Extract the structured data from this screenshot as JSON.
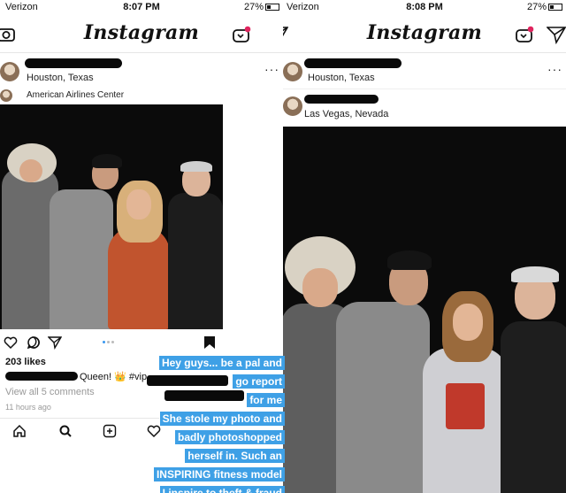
{
  "left": {
    "status": {
      "carrier": "Verizon",
      "time": "8:07 PM",
      "battery": "27%"
    },
    "app_title": "Instagram",
    "post": {
      "location": "Houston, Texas",
      "prev_location": "American Airlines Center",
      "likes": "203 likes",
      "caption_text": "Queen! 👑 #vip",
      "comments_link": "View all 5 comments",
      "time_ago": "11 hours ago"
    }
  },
  "right": {
    "status": {
      "carrier": "Verizon",
      "time": "8:08 PM",
      "battery": "27%"
    },
    "app_title": "Instagram",
    "first_location": "Houston, Texas",
    "post": {
      "location": "Las Vegas, Nevada"
    }
  },
  "annotation": {
    "lines": [
      "Hey guys... be a pal and",
      "go report",
      "for me",
      "She stole my photo and",
      "badly photoshopped",
      "herself in.  Such an",
      "INSPIRING fitness model",
      "I inspire to theft & fraud"
    ]
  },
  "colors": {
    "annotation_bg": "#3ea0e6",
    "photo_bg": "#0b0b0b",
    "notification_dot": "#e0245e"
  }
}
